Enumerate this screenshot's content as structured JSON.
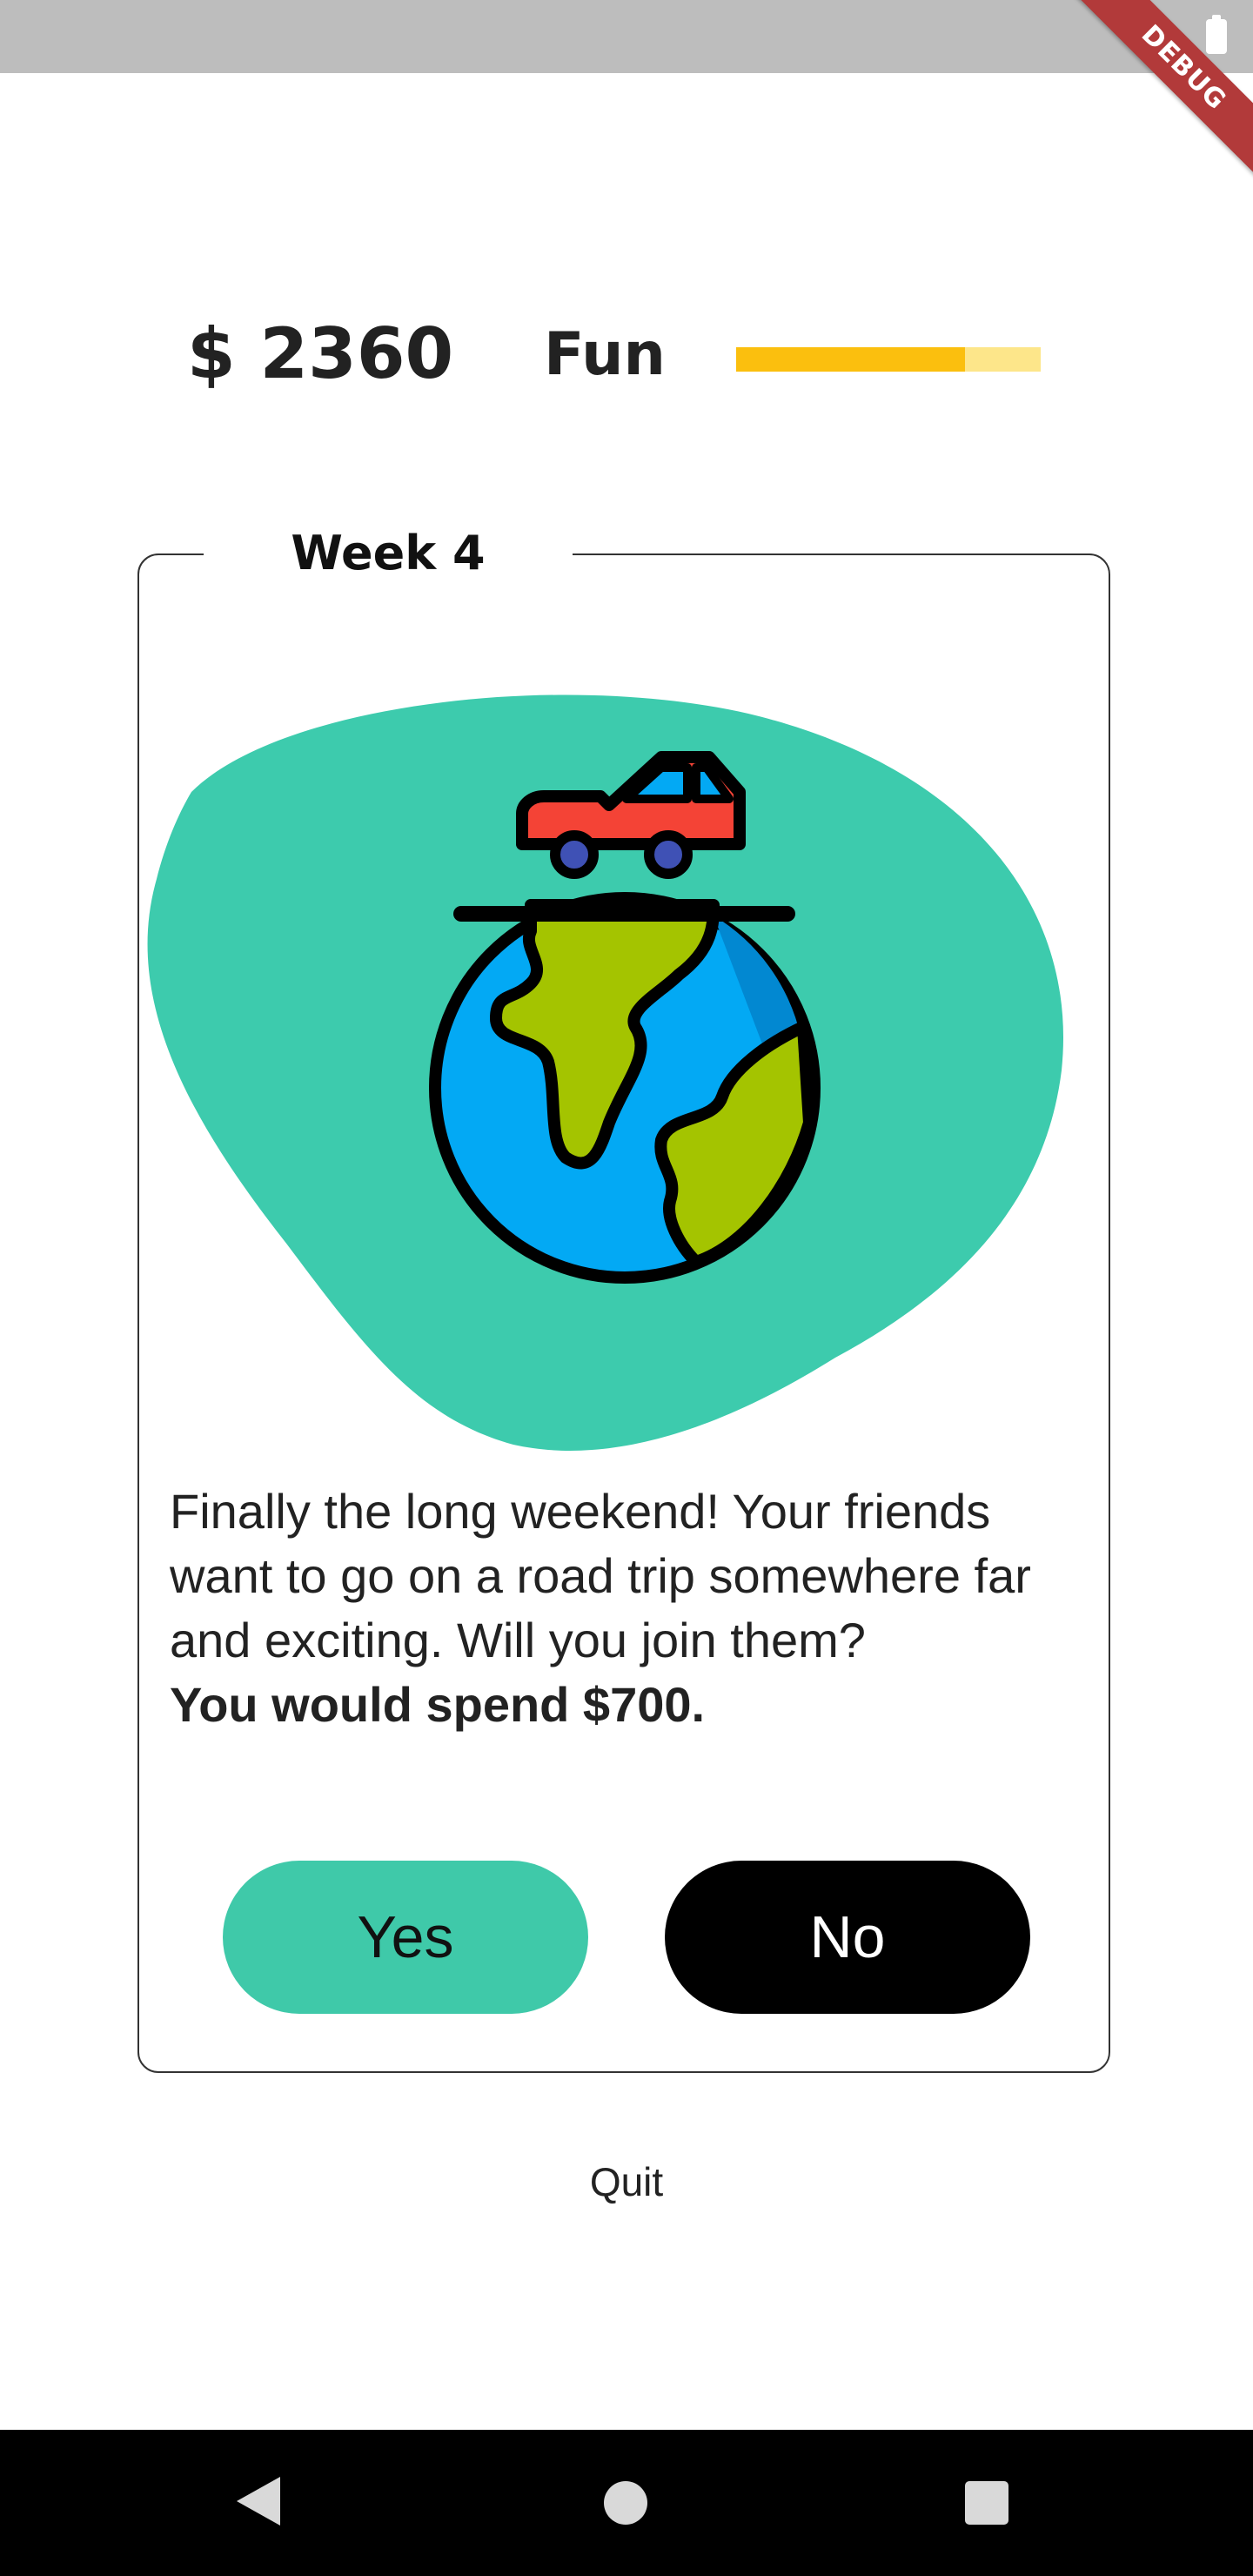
{
  "debug_banner": "DEBUG",
  "header": {
    "money": "$ 2360",
    "fun_label": "Fun",
    "fun_level_fraction": 0.75
  },
  "card": {
    "week_label": "Week 4",
    "illustration_icon": "road-trip-globe-car-icon",
    "story_text": "Finally the long weekend! Your friends want to go on a road trip somewhere far and exciting. Will you join them?",
    "story_cost": "You would spend $700.",
    "yes_label": "Yes",
    "no_label": "No"
  },
  "quit_label": "Quit",
  "colors": {
    "accent_teal": "#3fc9a9",
    "fun_bar_fill": "#fbbf0e",
    "fun_bar_track": "#fde68a",
    "button_no": "#000000",
    "debug_ribbon": "#b23a3a"
  }
}
